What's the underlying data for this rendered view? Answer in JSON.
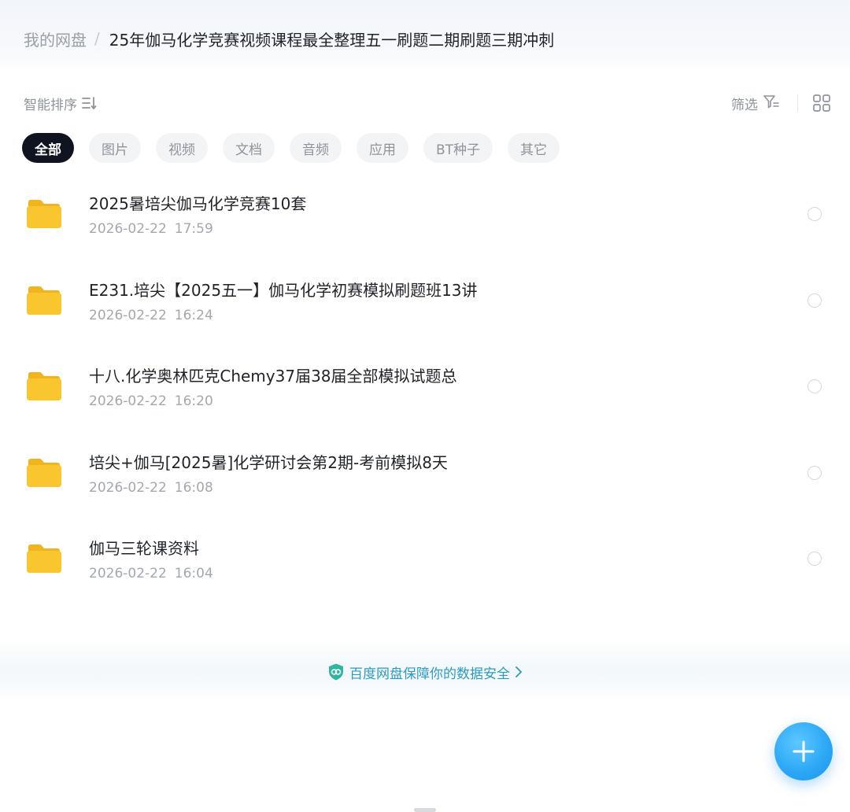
{
  "breadcrumb": {
    "root": "我的网盘",
    "separator": "/",
    "current": "25年伽马化学竞赛视频课程最全整理五一刷题二期刷题三期冲刺"
  },
  "toolbar": {
    "sort_label": "智能排序",
    "sort_icon": "sort-lines-icon",
    "filter_label": "筛选",
    "filter_icon": "filter-funnel-icon",
    "view_icon": "grid-view-icon"
  },
  "categories": [
    {
      "label": "全部",
      "active": true
    },
    {
      "label": "图片",
      "active": false
    },
    {
      "label": "视频",
      "active": false
    },
    {
      "label": "文档",
      "active": false
    },
    {
      "label": "音频",
      "active": false
    },
    {
      "label": "应用",
      "active": false
    },
    {
      "label": "BT种子",
      "active": false
    },
    {
      "label": "其它",
      "active": false
    }
  ],
  "files": [
    {
      "name": "2025暑培尖伽马化学竞赛10套",
      "date": "2026-02-22",
      "time": "17:59",
      "icon": "folder-icon"
    },
    {
      "name": "E231.培尖【2025五一】伽马化学初赛模拟刷题班13讲",
      "date": "2026-02-22",
      "time": "16:24",
      "icon": "folder-icon"
    },
    {
      "name": "十八.化学奥林匹克Chemy37届38届全部模拟试题总",
      "date": "2026-02-22",
      "time": "16:20",
      "icon": "folder-icon"
    },
    {
      "name": "培尖+伽马[2025暑]化学研讨会第2期-考前模拟8天",
      "date": "2026-02-22",
      "time": "16:08",
      "icon": "folder-icon"
    },
    {
      "name": "伽马三轮课资料",
      "date": "2026-02-22",
      "time": "16:04",
      "icon": "folder-icon"
    }
  ],
  "security": {
    "text": "百度网盘保障你的数据安全",
    "icon": "shield-icon"
  },
  "fab": {
    "icon": "plus-icon"
  },
  "colors": {
    "folder": "#f9c630",
    "accent": "#2aa6f5",
    "chip_active_bg": "#0f1420",
    "security_text": "#2c9bbd"
  }
}
